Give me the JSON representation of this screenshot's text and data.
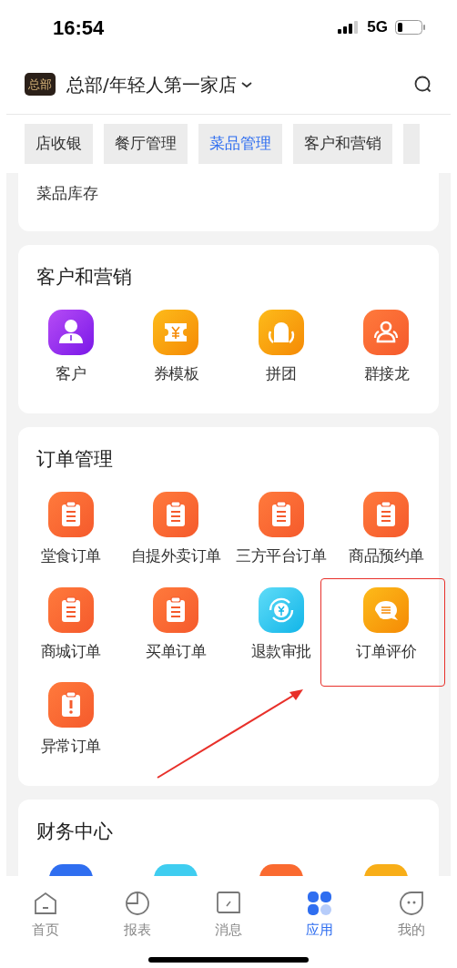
{
  "status_bar": {
    "time": "16:54",
    "network": "5G"
  },
  "header": {
    "badge": "总部",
    "title": "总部/年轻人第一家店"
  },
  "tabs": [
    {
      "label": "店收银",
      "selected": false
    },
    {
      "label": "餐厅管理",
      "selected": false
    },
    {
      "label": "菜品管理",
      "selected": true
    },
    {
      "label": "客户和营销",
      "selected": false
    }
  ],
  "sections": [
    {
      "items": [
        {
          "label": "菜品库存"
        }
      ]
    },
    {
      "title": "客户和营销",
      "items": [
        {
          "label": "客户",
          "kind": "person"
        },
        {
          "label": "券模板",
          "kind": "ticket"
        },
        {
          "label": "拼团",
          "kind": "hug"
        },
        {
          "label": "群接龙",
          "kind": "group"
        }
      ]
    },
    {
      "title": "订单管理",
      "items": [
        {
          "label": "堂食订单",
          "kind": "clipboard",
          "highlighted": false
        },
        {
          "label": "自提外卖订单",
          "kind": "clipboard",
          "highlighted": false
        },
        {
          "label": "三方平台订单",
          "kind": "clipboard",
          "highlighted": false
        },
        {
          "label": "商品预约单",
          "kind": "clipboard",
          "highlighted": false
        },
        {
          "label": "商城订单",
          "kind": "clipboard",
          "highlighted": false
        },
        {
          "label": "买单订单",
          "kind": "clipboard",
          "highlighted": false
        },
        {
          "label": "退款审批",
          "kind": "refund",
          "highlighted": false
        },
        {
          "label": "订单评价",
          "kind": "chat",
          "highlighted": true
        },
        {
          "label": "异常订单",
          "kind": "alert",
          "highlighted": false
        }
      ]
    },
    {
      "title": "财务中心",
      "items": [
        {
          "kind": "tile",
          "color": "#2f6ef0"
        },
        {
          "kind": "tile",
          "color": "#3fcdf0"
        },
        {
          "kind": "tile",
          "color": "#fa6a30"
        },
        {
          "kind": "tile",
          "color": "#f8ae18"
        }
      ]
    }
  ],
  "bottom_nav": [
    {
      "label": "首页",
      "kind": "home",
      "selected": false
    },
    {
      "label": "报表",
      "kind": "chart",
      "selected": false
    },
    {
      "label": "消息",
      "kind": "message",
      "selected": false
    },
    {
      "label": "应用",
      "kind": "apps",
      "selected": true
    },
    {
      "label": "我的",
      "kind": "me",
      "selected": false
    }
  ]
}
